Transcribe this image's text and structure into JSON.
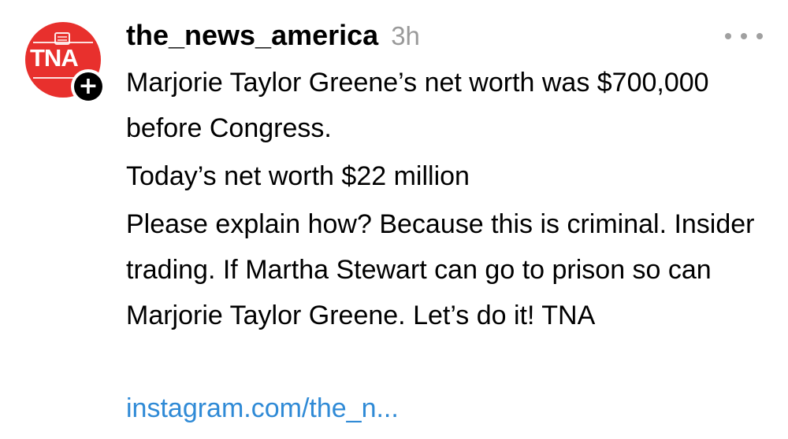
{
  "post": {
    "avatar": {
      "text": "TNA",
      "color": "#e8302d"
    },
    "username": "the_news_america",
    "timestamp": "3h",
    "follow_icon": "plus-icon",
    "more_icon": "more-horizontal-icon",
    "paragraphs": [
      "Marjorie Taylor Greene’s net worth was $700,000 before Congress.",
      "Today’s net worth $22 million",
      "Please explain how? Because this is criminal. Insider trading. If Martha Stewart can go to prison so can Marjorie Taylor Greene. Let’s do it! TNA"
    ],
    "link": "instagram.com/the_n...",
    "link_color": "#2f8ad6"
  }
}
